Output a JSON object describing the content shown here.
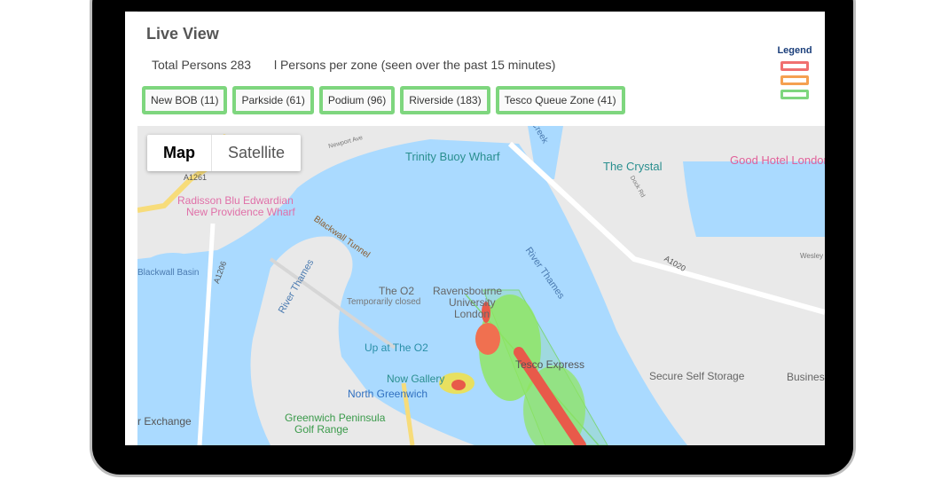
{
  "header": {
    "title": "Live View",
    "total_persons": "Total Persons 283",
    "persons_per_zone": "l Persons per zone (seen over the past 15 minutes)"
  },
  "zones": [
    {
      "label": "New BOB (11)",
      "status_color": "#7ed67e"
    },
    {
      "label": "Parkside (61)",
      "status_color": "#7ed67e"
    },
    {
      "label": "Podium (96)",
      "status_color": "#7ed67e"
    },
    {
      "label": "Riverside (183)",
      "status_color": "#7ed67e"
    },
    {
      "label": "Tesco Queue Zone (41)",
      "status_color": "#7ed67e"
    }
  ],
  "legend": {
    "title": "Legend",
    "colors": [
      "#f07070",
      "#f5a050",
      "#7ed67e"
    ]
  },
  "map": {
    "toggle": {
      "map": "Map",
      "satellite": "Satellite",
      "selected": "Map"
    },
    "labels": {
      "trinity": "Trinity Buoy Wharf",
      "crystal": "The Crystal",
      "good_hotel": "Good Hotel London",
      "radisson1": "Radisson Blu Edwardian",
      "radisson2": "New Providence Wharf",
      "blackwall_tunnel": "Blackwall Tunnel",
      "blackwall_basin": "Blackwall Basin",
      "a1206": "A1206",
      "a1261": "A1261",
      "a1020": "A1020",
      "river_thames_1": "River Thames",
      "river_thames_2": "River Thames",
      "o2": "The O2",
      "o2_closed": "Temporarily closed",
      "ravensbourne1": "Ravensbourne",
      "ravensbourne2": "University",
      "ravensbourne3": "London",
      "up_at_o2": "Up at The O2",
      "tesco": "Tesco Express",
      "now_gallery": "Now Gallery",
      "north_greenwich": "North Greenwich",
      "golf1": "Greenwich Peninsula",
      "golf2": "Golf Range",
      "exchange": "r Exchange",
      "secure_storage": "Secure Self Storage",
      "business": "Busines",
      "creek": "Creek",
      "newport": "Newport Ave",
      "dock_rd": "Dock Rd",
      "wesley": "Wesley"
    }
  }
}
